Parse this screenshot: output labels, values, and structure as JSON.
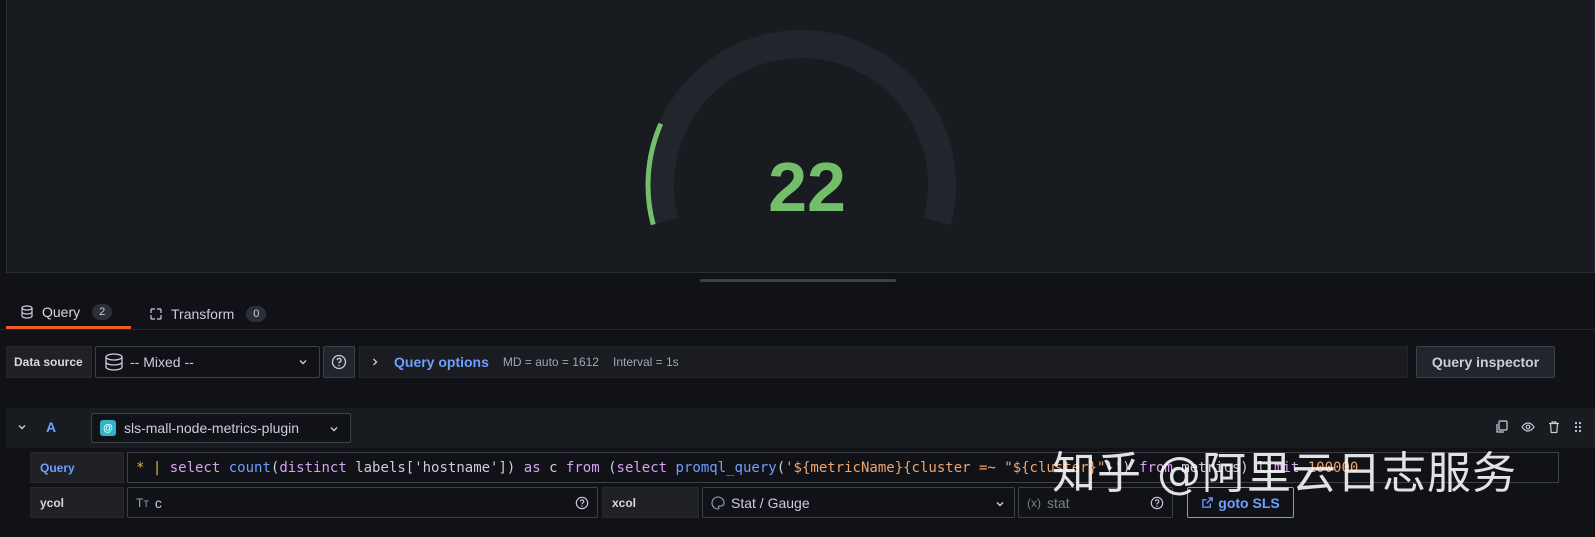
{
  "panel": {
    "gauge_value": "22",
    "gauge_fraction": 0.06,
    "colors": {
      "value": "#73bf69",
      "track": "#22252b"
    }
  },
  "tabs": [
    {
      "label": "Query",
      "count": "2",
      "icon": "database-icon"
    },
    {
      "label": "Transform",
      "count": "0",
      "icon": "transform-icon"
    }
  ],
  "toolbar": {
    "datasource_label": "Data source",
    "datasource_value": "-- Mixed --",
    "query_options_title": "Query options",
    "md_text": "MD = auto = 1612",
    "interval_text": "Interval = 1s",
    "query_inspector_label": "Query inspector"
  },
  "query_a": {
    "ref_id": "A",
    "datasource": "sls-mall-node-metrics-plugin",
    "query_label": "Query",
    "query_tokens": [
      {
        "t": "* | ",
        "c": "op"
      },
      {
        "t": "select ",
        "c": "k"
      },
      {
        "t": "count",
        "c": "f"
      },
      {
        "t": "(",
        "c": "p"
      },
      {
        "t": "distinct ",
        "c": "k"
      },
      {
        "t": "labels['hostname']) ",
        "c": "p"
      },
      {
        "t": "as ",
        "c": "k"
      },
      {
        "t": "c ",
        "c": "p"
      },
      {
        "t": "from ",
        "c": "k"
      },
      {
        "t": "(",
        "c": "p"
      },
      {
        "t": "select ",
        "c": "k"
      },
      {
        "t": "promql_query",
        "c": "f"
      },
      {
        "t": "(",
        "c": "p"
      },
      {
        "t": "'${metricName}{cluster =~ \"${cluster}\"}'",
        "c": "s"
      },
      {
        "t": ") ",
        "c": "p"
      },
      {
        "t": "from ",
        "c": "k"
      },
      {
        "t": "metrics) ",
        "c": "p"
      },
      {
        "t": "limit ",
        "c": "k"
      },
      {
        "t": "100000",
        "c": "s"
      }
    ],
    "ycol_label": "ycol",
    "ycol_value": "c",
    "xcol_label": "xcol",
    "xcol_value": "Stat / Gauge",
    "stat_placeholder": "stat",
    "goto_label": "goto SLS"
  },
  "watermark": "知乎 @阿里云日志服务"
}
